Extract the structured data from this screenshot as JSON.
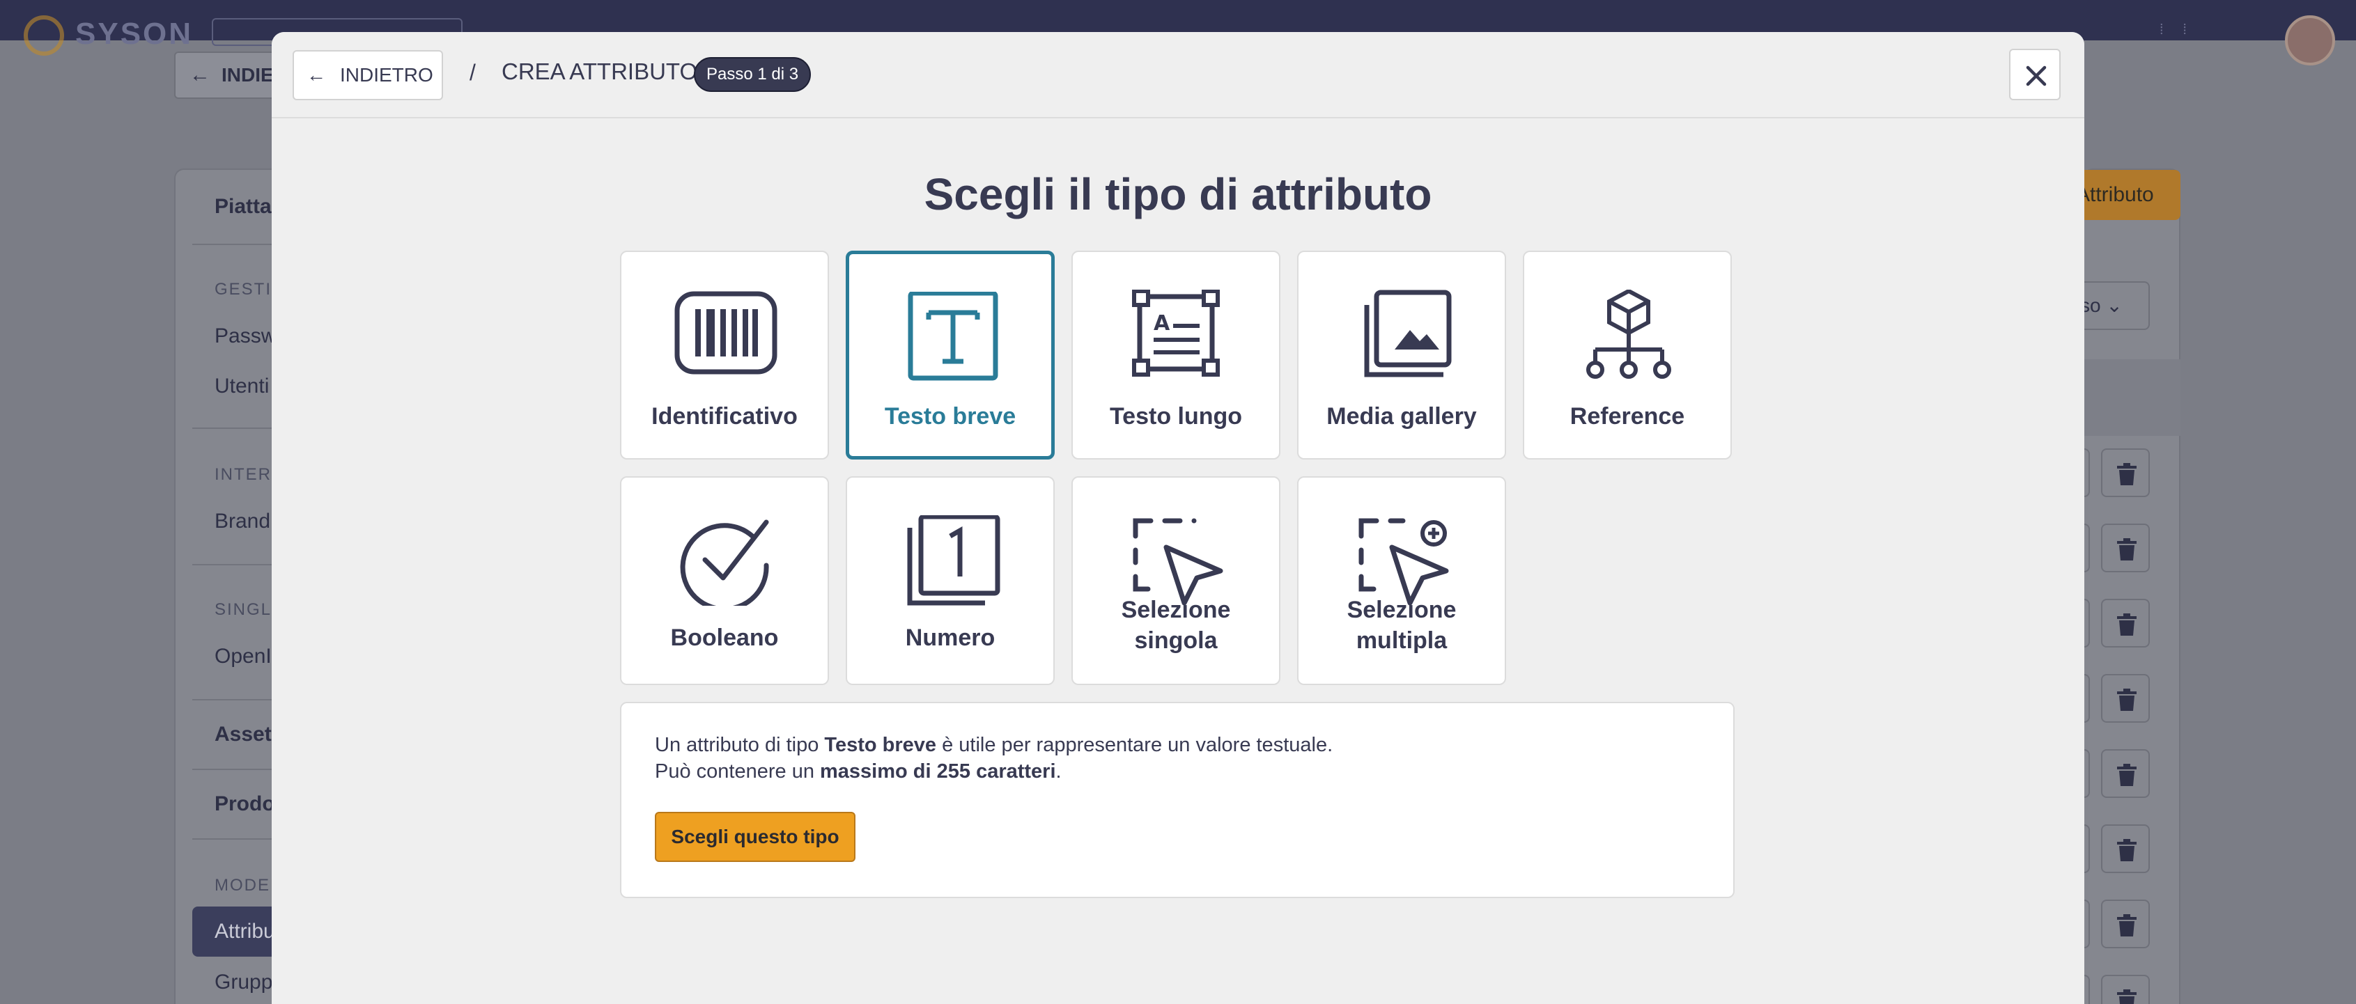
{
  "background": {
    "logo_text": "SYSON",
    "back_label": "INDIETRO",
    "sidebar": {
      "section_title": "Piattaforma",
      "groups": [
        {
          "heading": "GESTIONE",
          "items": [
            "Password",
            "Utenti"
          ]
        },
        {
          "heading": "INTERFACCIA",
          "items": [
            "Brand"
          ]
        },
        {
          "heading": "SINGLE SIGN-ON",
          "items": [
            "OpenID"
          ]
        }
      ],
      "sections": [
        "Asset",
        "Prodotti"
      ],
      "model_heading": "MODELLO",
      "active_item": "Attributi",
      "next_item": "Gruppi"
    },
    "add_button": "Attributo",
    "select_value": "sso"
  },
  "modal": {
    "back_label": "INDIETRO",
    "separator": "/",
    "breadcrumb": "CREA ATTRIBUTO",
    "step_badge": "Passo 1 di 3",
    "title": "Scegli il tipo di attributo",
    "types": [
      {
        "label": "Identificativo",
        "icon": "barcode-icon",
        "selected": false
      },
      {
        "label": "Testo breve",
        "icon": "text-short-icon",
        "selected": true
      },
      {
        "label": "Testo lungo",
        "icon": "text-long-icon",
        "selected": false
      },
      {
        "label": "Media gallery",
        "icon": "media-gallery-icon",
        "selected": false
      },
      {
        "label": "Reference",
        "icon": "reference-icon",
        "selected": false
      },
      {
        "label": "Booleano",
        "icon": "check-circle-icon",
        "selected": false
      },
      {
        "label": "Numero",
        "icon": "number-icon",
        "selected": false
      },
      {
        "label": "Selezione singola",
        "label_line1": "Selezione",
        "label_line2": "singola",
        "icon": "single-select-icon",
        "selected": false
      },
      {
        "label": "Selezione multipla",
        "label_line1": "Selezione",
        "label_line2": "multipla",
        "icon": "multi-select-icon",
        "selected": false
      }
    ],
    "description": {
      "line1_pre": "Un attributo di tipo ",
      "line1_bold": "Testo breve",
      "line1_post": " è utile per rappresentare un valore testuale.",
      "line2_pre": "Può contenere un ",
      "line2_bold": "massimo di 255 caratteri",
      "line2_post": "."
    },
    "choose_button": "Scegli questo tipo"
  },
  "colors": {
    "selected_accent": "#2a7c98",
    "primary_button": "#eea021",
    "dark_text": "#383a52"
  }
}
